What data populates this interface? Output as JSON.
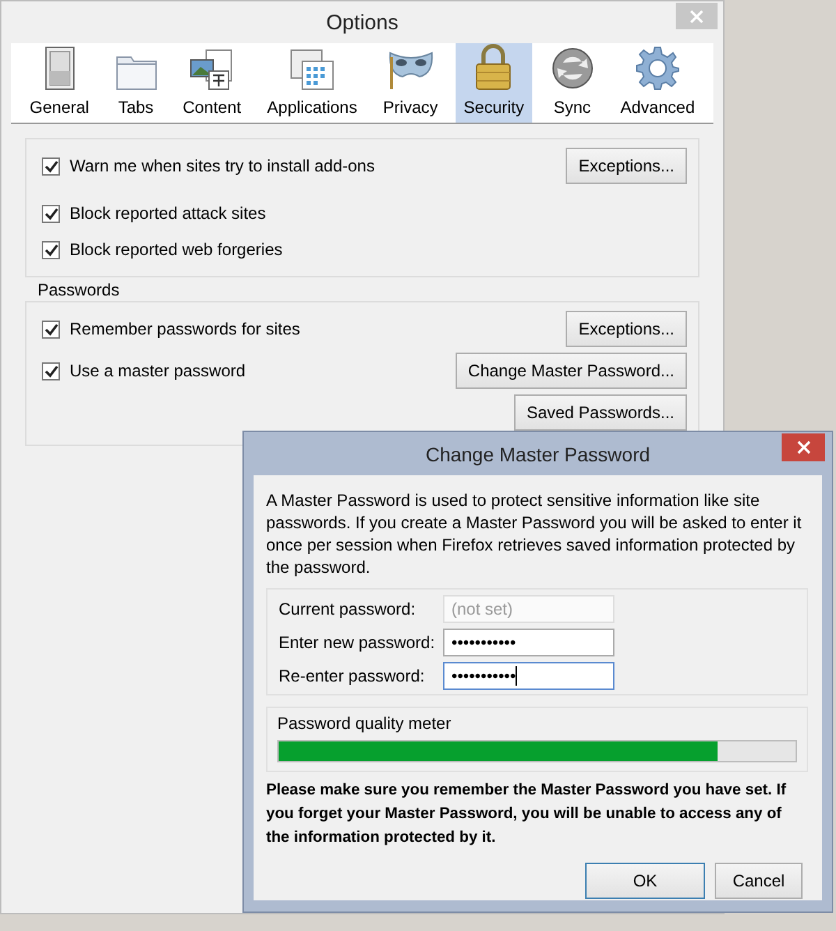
{
  "options_window": {
    "title": "Options",
    "tabs": [
      {
        "label": "General",
        "selected": false
      },
      {
        "label": "Tabs",
        "selected": false
      },
      {
        "label": "Content",
        "selected": false
      },
      {
        "label": "Applications",
        "selected": false
      },
      {
        "label": "Privacy",
        "selected": false
      },
      {
        "label": "Security",
        "selected": true
      },
      {
        "label": "Sync",
        "selected": false
      },
      {
        "label": "Advanced",
        "selected": false
      }
    ],
    "general_group": {
      "rows": [
        {
          "label": "Warn me when sites try to install add-ons",
          "checked": true,
          "buttons": [
            "Exceptions..."
          ]
        },
        {
          "label": "Block reported attack sites",
          "checked": true,
          "buttons": []
        },
        {
          "label": "Block reported web forgeries",
          "checked": true,
          "buttons": []
        }
      ]
    },
    "passwords_group": {
      "title": "Passwords",
      "rows": [
        {
          "label": "Remember passwords for sites",
          "checked": true,
          "buttons": [
            "Exceptions..."
          ]
        },
        {
          "label": "Use a master password",
          "checked": true,
          "buttons": [
            "Change Master Password...",
            "Saved Passwords..."
          ]
        }
      ]
    }
  },
  "dialog": {
    "title": "Change Master Password",
    "intro": "A Master Password is used to protect sensitive information like site passwords. If you create a Master Password you will be asked to enter it once per session when Firefox retrieves saved information protected by the password.",
    "fields": [
      {
        "label": "Current password:",
        "placeholder": "(not set)",
        "disabled": true,
        "focused": false
      },
      {
        "label": "Enter new password:",
        "value": "•••••••••••",
        "disabled": false,
        "focused": false
      },
      {
        "label": "Re-enter password:",
        "value": "•••••••••••",
        "disabled": false,
        "focused": true
      }
    ],
    "meter": {
      "label": "Password quality meter",
      "level": 0.85
    },
    "warning": "Please make sure you remember the Master Password you have set. If you forget your Master Password, you will be unable to access any of the information protected by it.",
    "buttons": [
      {
        "label": "OK",
        "default": true
      },
      {
        "label": "Cancel",
        "default": false
      }
    ]
  }
}
